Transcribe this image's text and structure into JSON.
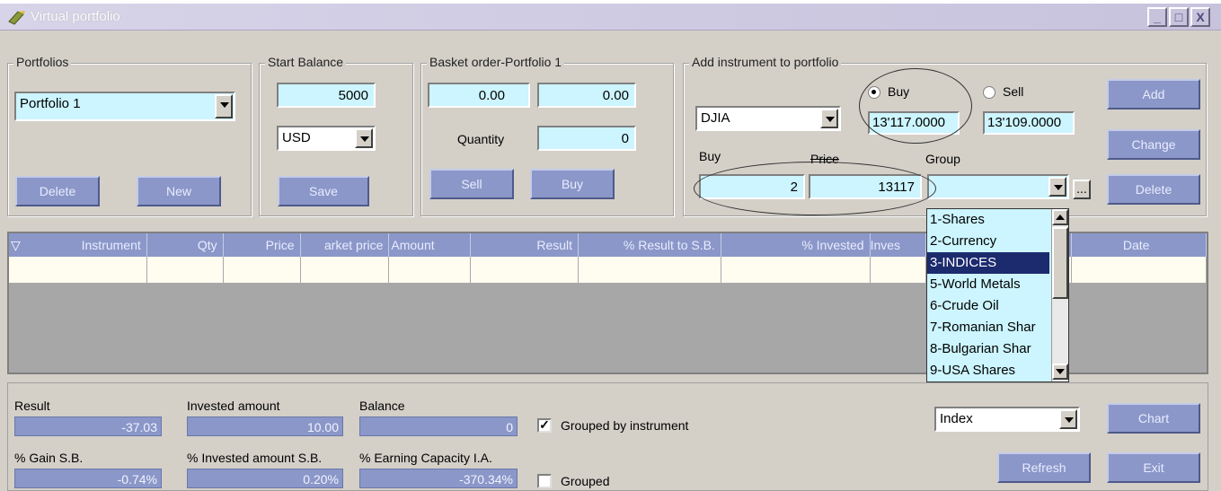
{
  "window": {
    "title": "Virtual portfolio",
    "min": "_",
    "max": "□",
    "close": "X"
  },
  "portfolios": {
    "legend": "Portfolios",
    "selected": "Portfolio 1",
    "delete_label": "Delete",
    "new_label": "New"
  },
  "start_balance": {
    "legend": "Start Balance",
    "value": "5000",
    "currency": "USD",
    "save_label": "Save"
  },
  "basket": {
    "legend": "Basket order-Portfolio 1",
    "value1": "0.00",
    "value2": "0.00",
    "quantity_label": "Quantity",
    "quantity": "0",
    "sell_label": "Sell",
    "buy_label": "Buy"
  },
  "add_instrument": {
    "legend": "Add instrument to portfolio",
    "instrument": "DJIA",
    "buy_radio": "Buy",
    "sell_radio": "Sell",
    "buy_price": "13'117.0000",
    "sell_price": "13'109.0000",
    "buy_label": "Buy",
    "price_label": "Price",
    "group_label": "Group",
    "quantity": "2",
    "price": "13117",
    "ellipsis": "...",
    "add_label": "Add",
    "change_label": "Change",
    "delete_label": "Delete"
  },
  "group_options": [
    "1-Shares",
    "2-Currency",
    "3-INDICES",
    "5-World Metals",
    "6-Crude Oil",
    "7-Romanian Shar",
    "8-Bulgarian Shar",
    "9-USA Shares"
  ],
  "grid": {
    "filter_icon": "▽",
    "columns": [
      "Instrument",
      "Qty",
      "Price",
      "arket price",
      "Amount",
      "Result",
      "% Result to S.B.",
      "% Invested",
      "Inves",
      "",
      "Date"
    ]
  },
  "summary": {
    "result_label": "Result",
    "result": "-37.03",
    "invested_label": "Invested amount",
    "invested": "10.00",
    "balance_label": "Balance",
    "balance": "0",
    "gain_label": "% Gain S.B.",
    "gain": "-0.74%",
    "invested_sb_label": "% Invested amount S.B.",
    "invested_sb": "0.20%",
    "earning_label": "% Earning Capacity I.A.",
    "earning": "-370.34%",
    "grouped_by_instrument": "Grouped by instrument",
    "grouped": "Grouped",
    "view": "Index",
    "chart_label": "Chart",
    "refresh_label": "Refresh",
    "exit_label": "Exit"
  }
}
